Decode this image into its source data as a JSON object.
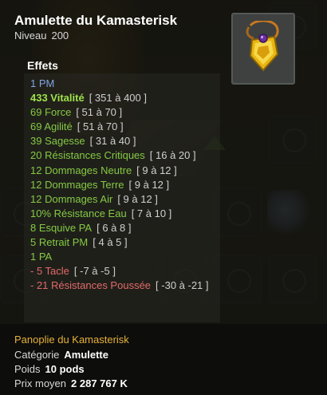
{
  "item": {
    "name": "Amulette du Kamasterisk",
    "level_label": "Niveau",
    "level_value": "200"
  },
  "effects_title": "Effets",
  "effects": [
    {
      "text": "1 PM",
      "range": "",
      "color": "blue"
    },
    {
      "text": "433 Vitalité",
      "range": "[ 351 à 400 ]",
      "color": "lime"
    },
    {
      "text": "69 Force",
      "range": "[ 51 à 70 ]",
      "color": "green"
    },
    {
      "text": "69 Agilité",
      "range": "[ 51 à 70 ]",
      "color": "green"
    },
    {
      "text": "39 Sagesse",
      "range": "[ 31 à 40 ]",
      "color": "green"
    },
    {
      "text": "20 Résistances Critiques",
      "range": "[ 16 à 20 ]",
      "color": "green"
    },
    {
      "text": "12 Dommages Neutre",
      "range": "[ 9 à 12 ]",
      "color": "green"
    },
    {
      "text": "12 Dommages Terre",
      "range": "[ 9 à 12 ]",
      "color": "green"
    },
    {
      "text": "12 Dommages Air",
      "range": "[ 9 à 12 ]",
      "color": "green"
    },
    {
      "text": "10% Résistance Eau",
      "range": "[ 7 à 10 ]",
      "color": "green"
    },
    {
      "text": "8 Esquive PA",
      "range": "[ 6 à 8 ]",
      "color": "green"
    },
    {
      "text": "5 Retrait PM",
      "range": "[ 4 à 5 ]",
      "color": "green"
    },
    {
      "text": "1 PA",
      "range": "",
      "color": "green"
    },
    {
      "text": "- 5 Tacle",
      "range": "[ -7 à -5 ]",
      "color": "red"
    },
    {
      "text": "- 21 Résistances Poussée",
      "range": "[ -30 à -21 ]",
      "color": "red"
    }
  ],
  "set_name": "Panoplie du Kamasterisk",
  "details": {
    "category_label": "Catégorie",
    "category_value": "Amulette",
    "weight_label": "Poids",
    "weight_value": "10 pods",
    "price_label": "Prix moyen",
    "price_value": "2 287 767 K"
  },
  "colors": {
    "blue": "#7fa6e2",
    "green": "#84c943",
    "lime": "#9fe24a",
    "red": "#e06a6a",
    "set_gold": "#e6b23a"
  },
  "icons": [
    "amulet-item-icon",
    "equipment-slot-ghost-icon",
    "pet-icon"
  ]
}
